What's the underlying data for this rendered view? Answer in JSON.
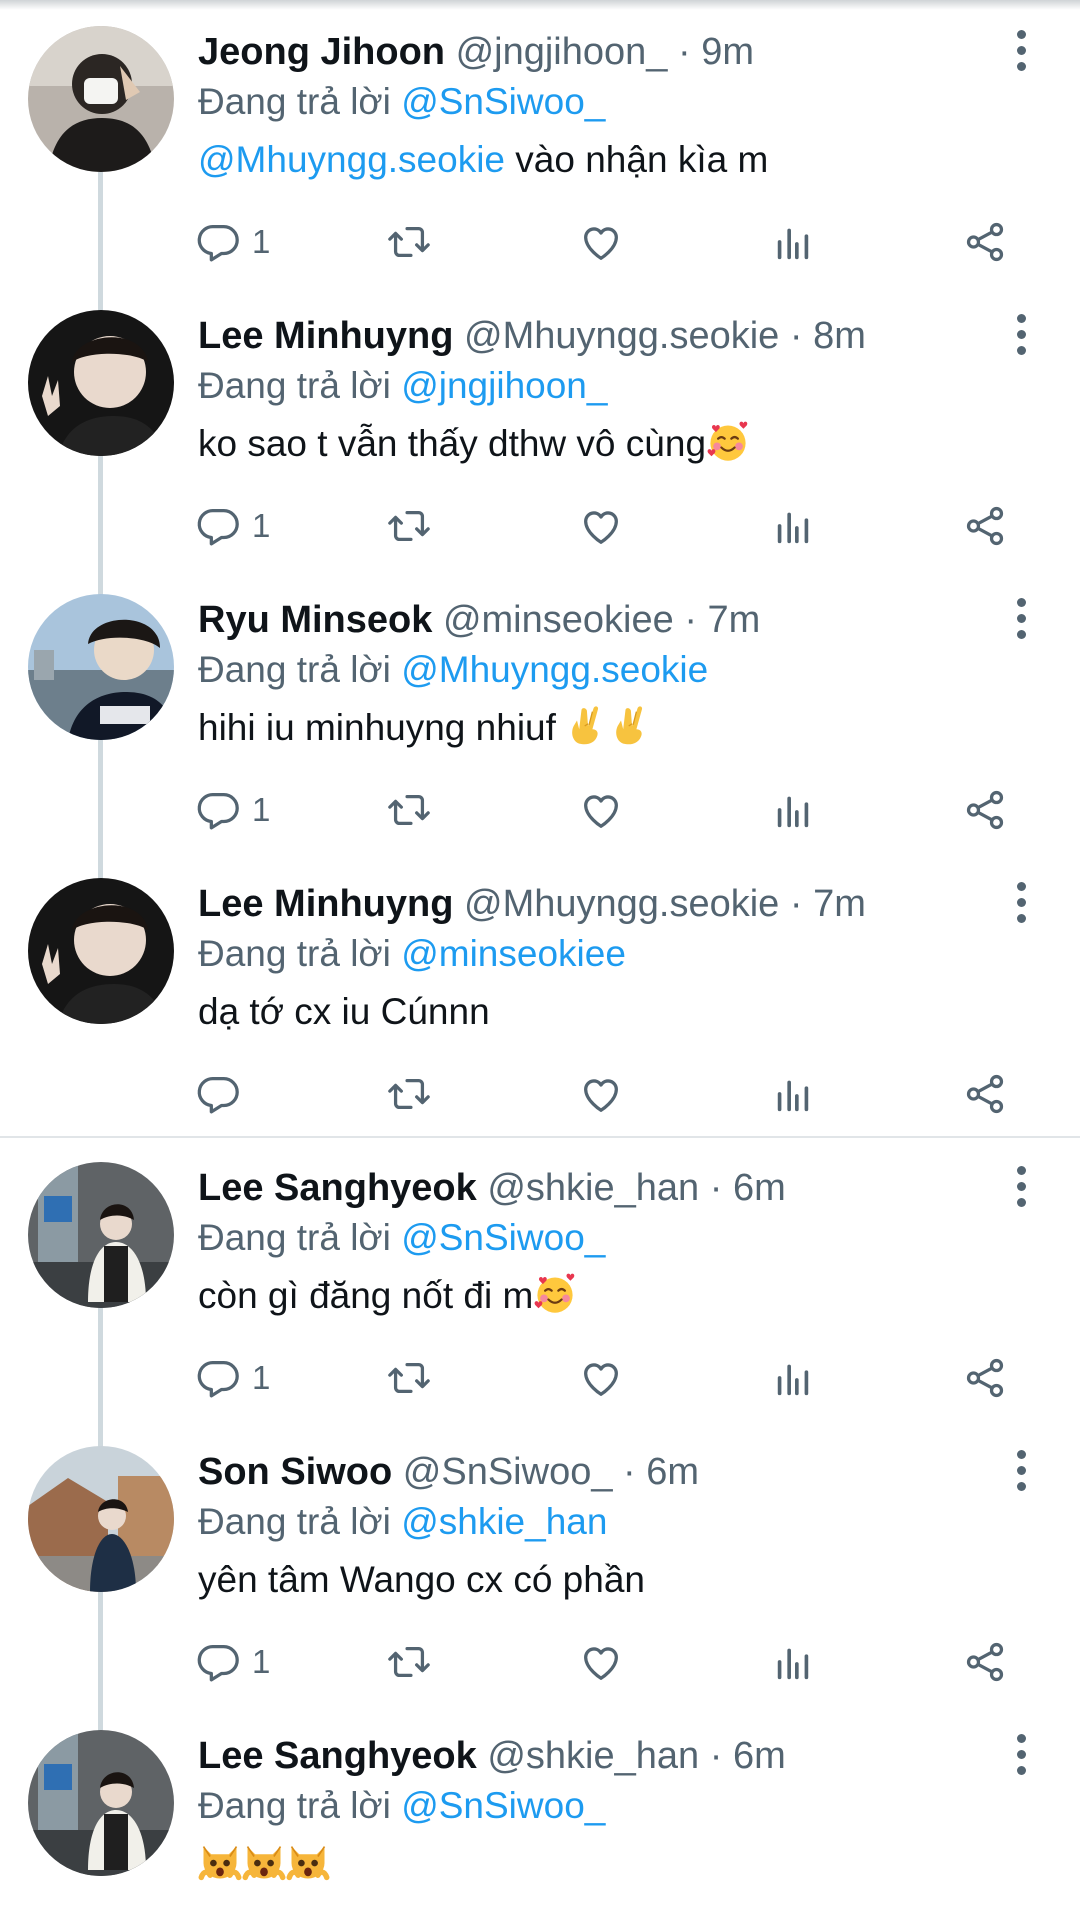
{
  "replying_prefix": "Đang trả lời",
  "tweets": [
    {
      "name": "Jeong Jihoon",
      "handle": "@jngjihoon_",
      "separator": "·",
      "time": "9m",
      "reply_to": "@SnSiwoo_",
      "text_mention": "@Mhuyngg.seokie",
      "text": " vào nhận kìa m",
      "reply_count": "1"
    },
    {
      "name": "Lee Minhuyng",
      "handle": "@Mhuyngg.seokie",
      "separator": "·",
      "time": "8m",
      "reply_to": "@jngjihoon_",
      "text": "ko sao t vẫn thấy dthw vô cùng",
      "emoji": "smiling-face-with-hearts",
      "reply_count": "1"
    },
    {
      "name": "Ryu Minseok",
      "handle": "@minseokiee",
      "separator": "·",
      "time": "7m",
      "reply_to": "@Mhuyngg.seokie",
      "text": "hihi iu minhuyng nhiuf ",
      "emoji": "crossed-fingers x2",
      "reply_count": "1"
    },
    {
      "name": "Lee Minhuyng",
      "handle": "@Mhuyngg.seokie",
      "separator": "·",
      "time": "7m",
      "reply_to": "@minseokiee",
      "text": "dạ tớ cx iu Cúnnn",
      "reply_count": ""
    },
    {
      "name": "Lee Sanghyeok",
      "handle": "@shkie_han",
      "separator": "·",
      "time": "6m",
      "reply_to": "@SnSiwoo_",
      "text": "còn gì đăng nốt đi m",
      "emoji": "smiling-face-with-hearts",
      "reply_count": "1"
    },
    {
      "name": "Son Siwoo",
      "handle": "@SnSiwoo_",
      "separator": "·",
      "time": "6m",
      "reply_to": "@shkie_han",
      "text": "yên tâm Wango cx có phần",
      "reply_count": "1"
    },
    {
      "name": "Lee Sanghyeok",
      "handle": "@shkie_han",
      "separator": "·",
      "time": "6m",
      "reply_to": "@SnSiwoo_",
      "text": "",
      "emoji": "weary-cat x3",
      "reply_count": ""
    }
  ],
  "icons": {
    "reply": "speech-bubble-icon",
    "retweet": "retweet-icon",
    "like": "heart-icon",
    "views": "bar-chart-icon",
    "share": "share-icon",
    "more": "vertical-dots-icon"
  },
  "colors": {
    "link": "#1d9bf0",
    "secondary_text": "#536471",
    "primary_text": "#0f1419",
    "thread_line": "#cfd9de"
  }
}
